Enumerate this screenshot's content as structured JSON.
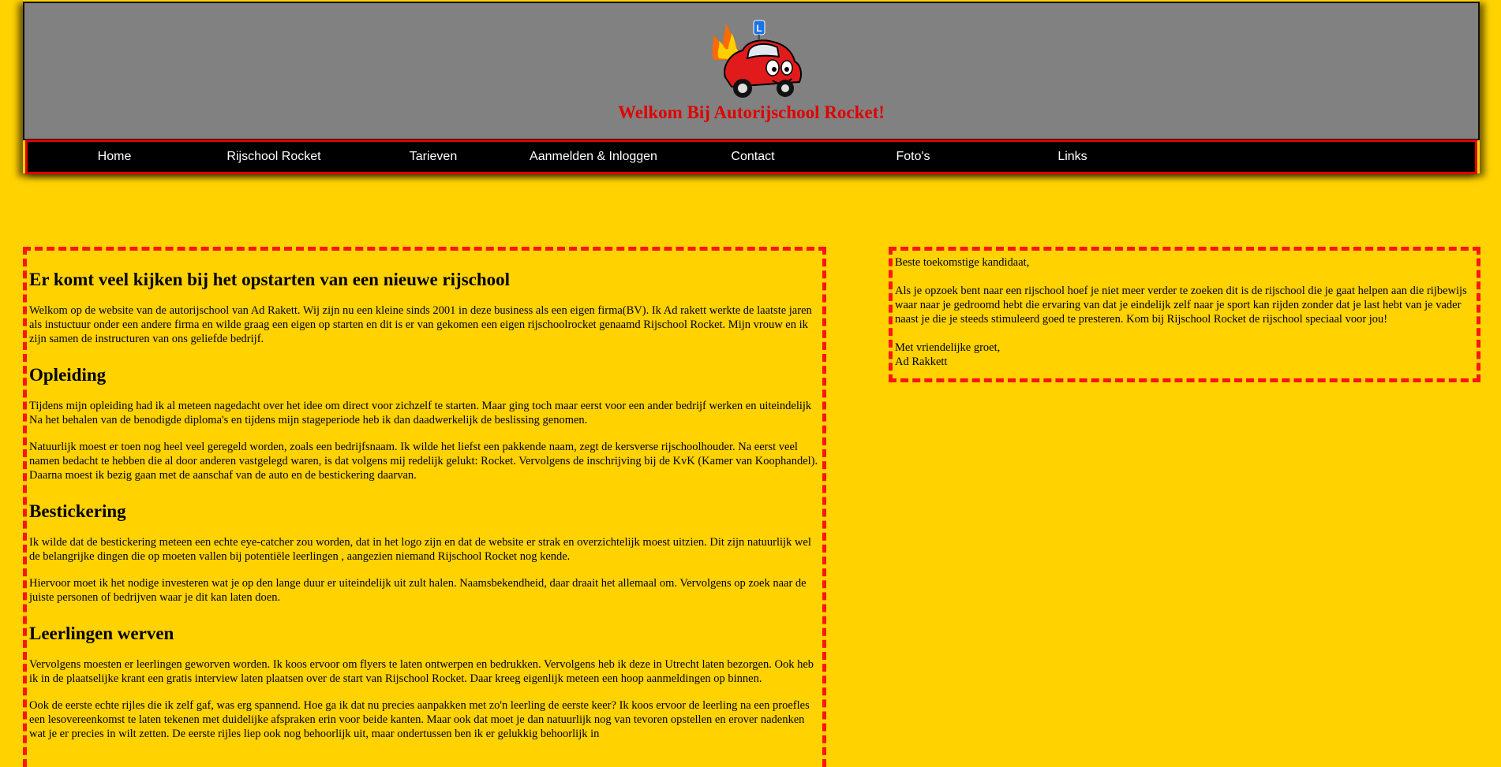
{
  "header": {
    "logo_icon": "rocket-car-mascot-logo-icon",
    "welcome": "Welkom Bij Autorijschool Rocket!"
  },
  "nav": {
    "items": [
      {
        "label": "Home"
      },
      {
        "label": "Rijschool Rocket"
      },
      {
        "label": "Tarieven"
      },
      {
        "label": "Aanmelden & Inloggen"
      },
      {
        "label": "Contact"
      },
      {
        "label": "Foto's"
      },
      {
        "label": "Links"
      }
    ]
  },
  "main": {
    "title": "Er komt veel kijken bij het opstarten van een nieuwe rijschool",
    "intro": "Welkom op de website van de autorijschool van Ad Rakett. Wij zijn nu een kleine sinds 2001 in deze business als een eigen firma(BV). Ik Ad rakett werkte de laatste jaren als instuctuur onder een andere firma en wilde graag een eigen op starten en dit is er van gekomen een eigen rijschoolrocket genaamd Rijschool Rocket. Mijn vrouw en ik zijn samen de instructuren van ons geliefde bedrijf.",
    "sections": [
      {
        "heading": "Opleiding",
        "paragraphs": [
          "Tijdens mijn opleiding had ik al meteen nagedacht over het idee om direct voor zichzelf te starten. Maar ging toch maar eerst voor een ander bedrijf werken en uiteindelijk Na het behalen van de benodigde diploma's en tijdens mijn stageperiode heb ik dan daadwerkelijk de beslissing genomen.",
          "Natuurlijk moest er toen nog heel veel geregeld worden, zoals een bedrijfsnaam. Ik wilde het liefst een pakkende naam, zegt de kersverse rijschoolhouder. Na eerst veel namen bedacht te hebben die al door anderen vastgelegd waren, is dat volgens mij redelijk gelukt: Rocket. Vervolgens de inschrijving bij de KvK (Kamer van Koophandel). Daarna moest ik bezig gaan met de aanschaf van de auto en de bestickering daarvan."
        ]
      },
      {
        "heading": "Bestickering",
        "paragraphs": [
          "Ik wilde dat de bestickering meteen een echte eye-catcher zou worden, dat in het logo zijn en dat de website er strak en overzichtelijk moest uitzien. Dit zijn natuurlijk wel de belangrijke dingen die op moeten vallen bij potentiële leerlingen , aangezien niemand Rijschool Rocket nog kende.",
          "Hiervoor moet ik het nodige investeren wat je op den lange duur er uiteindelijk uit zult halen. Naamsbekendheid, daar draait het allemaal om. Vervolgens op zoek naar de juiste personen of bedrijven waar je dit kan laten doen."
        ]
      },
      {
        "heading": "Leerlingen werven",
        "paragraphs": [
          "Vervolgens moesten er leerlingen geworven worden. Ik koos ervoor om flyers te laten ontwerpen en bedrukken. Vervolgens heb ik deze in Utrecht laten bezorgen. Ook heb ik in de  plaatselijke krant een gratis interview laten plaatsen over de start van Rijschool Rocket. Daar kreeg eigenlijk meteen een hoop aanmeldingen op binnen.",
          "Ook de eerste echte rijles die ik zelf gaf, was erg spannend. Hoe ga ik dat nu precies aanpakken met zo'n leerling de eerste keer? Ik koos ervoor de leerling na een proefles een lesovereenkomst te laten tekenen met duidelijke afspraken erin voor beide kanten. Maar ook dat moet je dan natuurlijk nog van tevoren opstellen en erover nadenken wat je er precies in wilt zetten. De eerste rijles liep ook nog behoorlijk uit, maar ondertussen ben ik er gelukkig behoorlijk in"
        ]
      }
    ]
  },
  "side": {
    "greeting": "Beste toekomstige kandidaat,",
    "message": "Als je opzoek bent naar een rijschool hoef je niet meer verder te zoeken dit is de rijschool die je gaat helpen aan die rijbewijs waar naar je gedroomd hebt die ervaring van dat je eindelijk zelf naar je sport kan rijden zonder dat je last hebt van je vader naast je die je steeds stimuleerd goed te presteren. Kom bij Rijschool Rocket de rijschool speciaal voor jou!",
    "closing": "Met vriendelijke groet,",
    "signature": "Ad Rakkett"
  },
  "colors": {
    "background": "#ffd200",
    "banner": "#818181",
    "accent_red": "#e00000",
    "nav_bg": "#000000"
  }
}
